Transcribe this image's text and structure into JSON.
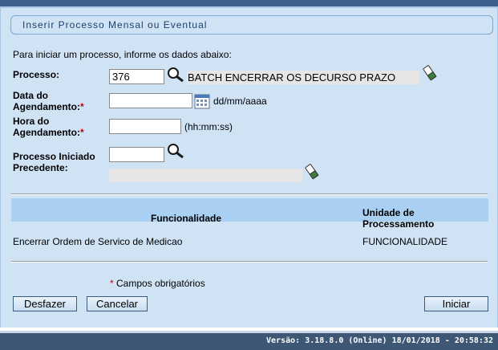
{
  "form": {
    "title": "Inserir Processo Mensal ou Eventual",
    "intro": "Para iniciar um processo, informe os dados abaixo:",
    "processo_label": "Processo:",
    "processo_value": "376",
    "processo_desc": "BATCH ENCERRAR OS DECURSO PRAZO",
    "data_label_1": "Data do",
    "data_label_2": "Agendamento:",
    "data_value": "",
    "data_hint": "dd/mm/aaaa",
    "hora_label_1": "Hora do",
    "hora_label_2": "Agendamento:",
    "hora_value": "",
    "hora_hint": "(hh:mm:ss)",
    "prec_label_1": "Processo Iniciado",
    "prec_label_2": "Precedente:",
    "prec_value": "",
    "prec_desc": "",
    "required_mark": "*"
  },
  "table": {
    "col_func": "Funcionalidade",
    "col_unit_1": "Unidade de",
    "col_unit_2": "Processamento",
    "rows": [
      {
        "funcionalidade": "Encerrar Ordem de Servico de Medicao",
        "unidade": "FUNCIONALIDADE"
      }
    ]
  },
  "required_note": "Campos obrigatórios",
  "buttons": {
    "desfazer": "Desfazer",
    "cancelar": "Cancelar",
    "iniciar": "Iniciar"
  },
  "footer": {
    "version": "Versão: 3.18.8.0 (Online) 18/01/2018 - 20:58:32"
  },
  "colors": {
    "panel": "#cfe3f5",
    "header": "#a9cff2",
    "footer": "#3d5774",
    "required": "#cc0000"
  },
  "icons": {
    "search": "magnifier-icon",
    "erase": "eraser-icon",
    "calendar": "calendar-icon"
  }
}
